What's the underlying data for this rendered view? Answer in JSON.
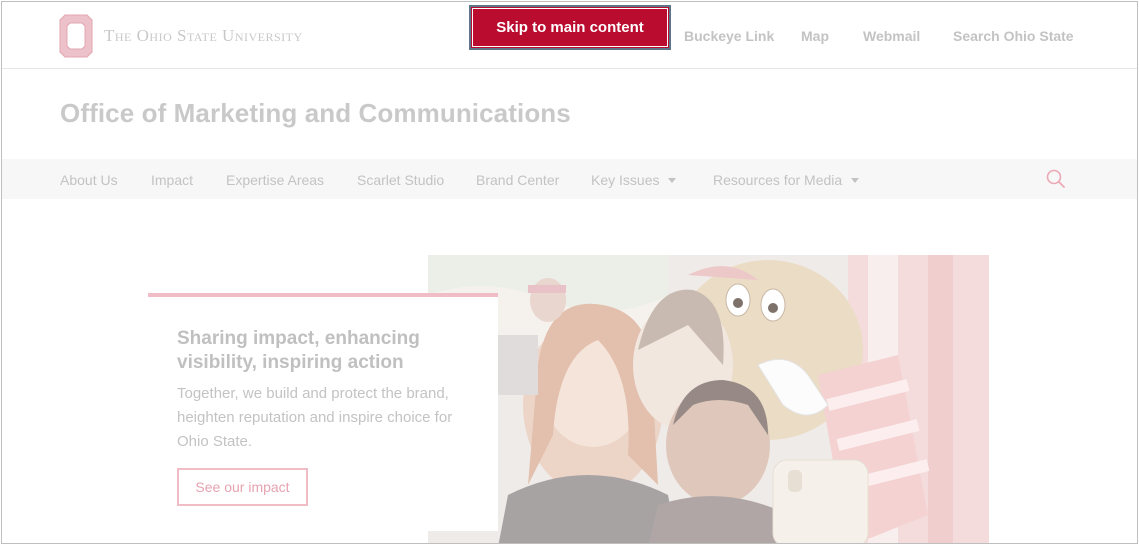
{
  "header": {
    "university_name": "The Ohio State University",
    "skip_link": "Skip to main content",
    "utility_links": [
      "Buckeye Link",
      "Map",
      "Webmail",
      "Search Ohio State"
    ]
  },
  "site": {
    "title": "Office of Marketing and Communications"
  },
  "nav": {
    "items": [
      {
        "label": "About Us",
        "dropdown": false
      },
      {
        "label": "Impact",
        "dropdown": false
      },
      {
        "label": "Expertise Areas",
        "dropdown": false
      },
      {
        "label": "Scarlet Studio",
        "dropdown": false
      },
      {
        "label": "Brand Center",
        "dropdown": false
      },
      {
        "label": "Key Issues",
        "dropdown": true
      },
      {
        "label": "Resources for Media",
        "dropdown": true
      }
    ],
    "search_icon": "search-icon"
  },
  "hero": {
    "title": "Sharing impact, enhancing visibility, inspiring action",
    "body": "Together, we build and protect the brand, heighten reputation and inspire choice for Ohio State.",
    "button": "See our impact"
  },
  "colors": {
    "scarlet": "#ba0c2f",
    "scarlet_faded": "#f0bcc6",
    "gray_text": "#c3c3c3"
  }
}
